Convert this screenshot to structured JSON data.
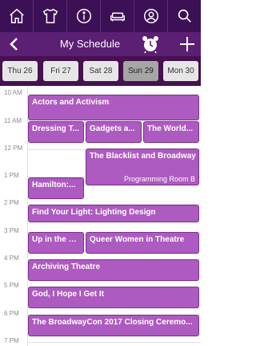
{
  "header": {
    "title": "My Schedule"
  },
  "days": [
    {
      "label": "Thu 26",
      "selected": false
    },
    {
      "label": "Fri 27",
      "selected": false
    },
    {
      "label": "Sat 28",
      "selected": false
    },
    {
      "label": "Sun 29",
      "selected": true
    },
    {
      "label": "Mon 30",
      "selected": false
    }
  ],
  "hours": [
    "10 AM",
    "11 AM",
    "12 PM",
    "1 PM",
    "2 PM",
    "3 PM",
    "4 PM",
    "5 PM",
    "6 PM",
    "7 PM"
  ],
  "events": [
    {
      "title": "Actors and Activism"
    },
    {
      "title": "Dressing T..."
    },
    {
      "title": "Gadgets a..."
    },
    {
      "title": "The World..."
    },
    {
      "title": "The Blacklist and Broadway",
      "room": "Programming Room B"
    },
    {
      "title": "Hamilton:..."
    },
    {
      "title": "Find Your Light: Lighting Design"
    },
    {
      "title": "Up in the C..."
    },
    {
      "title": "Queer Women in Theatre"
    },
    {
      "title": "Archiving Theatre"
    },
    {
      "title": "God, I Hope I Get It"
    },
    {
      "title": "The BroadwayCon 2017 Closing Ceremo..."
    }
  ],
  "colors": {
    "topbar": "#3c1055",
    "header": "#5b1f73",
    "datebar": "#45114f",
    "event": "#ad5bc0"
  },
  "icons": [
    "home-icon",
    "shirt-icon",
    "info-icon",
    "couch-icon",
    "user-icon",
    "search-icon"
  ]
}
